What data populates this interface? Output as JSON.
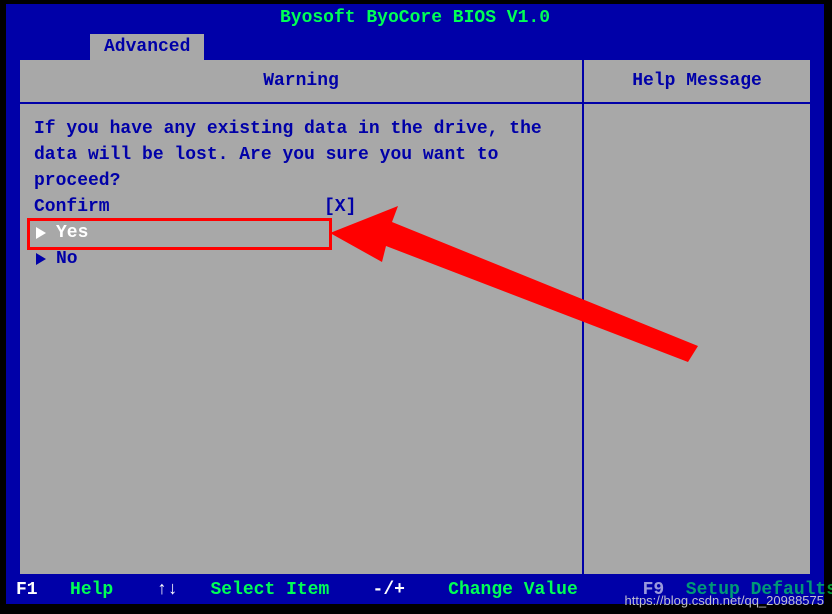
{
  "title": "Byosoft ByoCore BIOS V1.0",
  "tab": "Advanced",
  "header": {
    "warning": "Warning",
    "help": "Help Message"
  },
  "main": {
    "message": "If you have any existing data in the drive, the data will be lost. Are you sure you want to proceed?",
    "confirm_label": "Confirm",
    "confirm_value": "[X]",
    "yes": "Yes",
    "no": "No"
  },
  "footer": {
    "f1_key": "F1",
    "f1_label": "Help",
    "nav_key": "↑↓",
    "nav_label": "Select Item",
    "val_key": "-/+",
    "val_label": "Change Value",
    "f9_key": "F9",
    "f9_label": "Setup Defaults"
  },
  "watermark": "https://blog.csdn.net/qq_20988575"
}
